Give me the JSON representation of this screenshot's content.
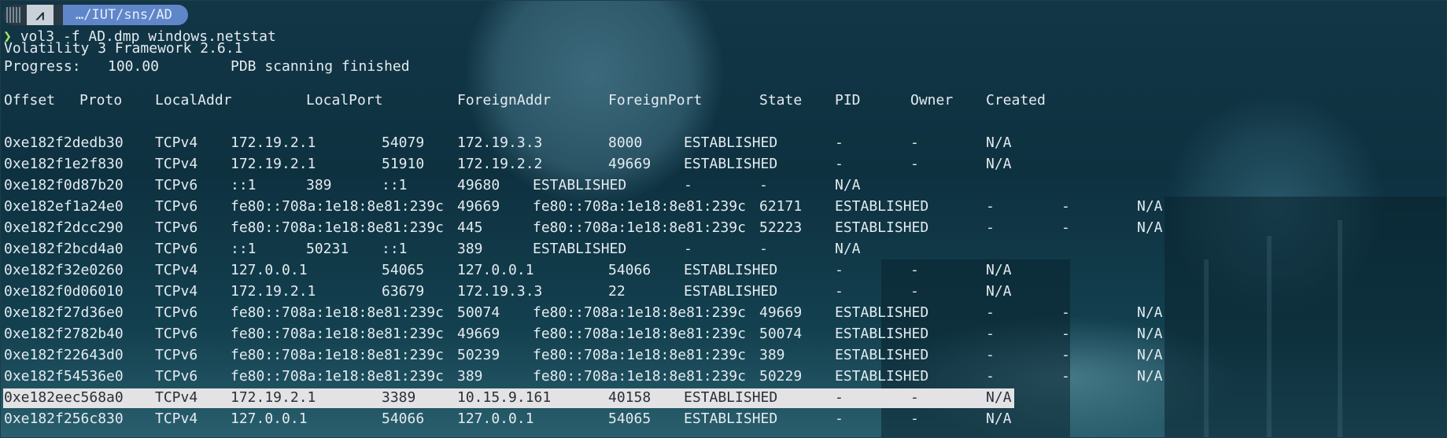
{
  "prompt": {
    "os_icon": "arch-linux-icon",
    "path": "…/IUT/sns/AD"
  },
  "command": {
    "chevron": "❯",
    "text": "vol3 -f AD.dmp windows.netstat"
  },
  "banner": "Volatility 3 Framework 2.6.1",
  "progress": {
    "label": "Progress:",
    "value": "100.00",
    "status": "PDB scanning finished"
  },
  "headers": [
    "Offset",
    "Proto",
    "LocalAddr",
    "LocalPort",
    "ForeignAddr",
    "ForeignPort",
    "State",
    "PID",
    "Owner",
    "Created"
  ],
  "rows": [
    [
      "0xe182f2dedb30",
      "TCPv4",
      "172.19.2.1",
      "54079",
      "172.19.3.3",
      "8000",
      "ESTABLISHED",
      "-",
      "-",
      "N/A"
    ],
    [
      "0xe182f1e2f830",
      "TCPv4",
      "172.19.2.1",
      "51910",
      "172.19.2.2",
      "49669",
      "ESTABLISHED",
      "-",
      "-",
      "N/A"
    ],
    [
      "0xe182f0d87b20",
      "TCPv6",
      "::1",
      "389",
      "::1",
      "49680",
      "ESTABLISHED",
      "-",
      "-",
      "N/A"
    ],
    [
      "0xe182ef1a24e0",
      "TCPv6",
      "fe80::708a:1e18:8e81:239c",
      "49669",
      "fe80::708a:1e18:8e81:239c",
      "62171",
      "ESTABLISHED",
      "-",
      "-",
      "N/A"
    ],
    [
      "0xe182f2dcc290",
      "TCPv6",
      "fe80::708a:1e18:8e81:239c",
      "445",
      "fe80::708a:1e18:8e81:239c",
      "52223",
      "ESTABLISHED",
      "-",
      "-",
      "N/A"
    ],
    [
      "0xe182f2bcd4a0",
      "TCPv6",
      "::1",
      "50231",
      "::1",
      "389",
      "ESTABLISHED",
      "-",
      "-",
      "N/A"
    ],
    [
      "0xe182f32e0260",
      "TCPv4",
      "127.0.0.1",
      "54065",
      "127.0.0.1",
      "54066",
      "ESTABLISHED",
      "-",
      "-",
      "N/A"
    ],
    [
      "0xe182f0d06010",
      "TCPv4",
      "172.19.2.1",
      "63679",
      "172.19.3.3",
      "22",
      "ESTABLISHED",
      "-",
      "-",
      "N/A"
    ],
    [
      "0xe182f27d36e0",
      "TCPv6",
      "fe80::708a:1e18:8e81:239c",
      "50074",
      "fe80::708a:1e18:8e81:239c",
      "49669",
      "ESTABLISHED",
      "-",
      "-",
      "N/A"
    ],
    [
      "0xe182f2782b40",
      "TCPv6",
      "fe80::708a:1e18:8e81:239c",
      "49669",
      "fe80::708a:1e18:8e81:239c",
      "50074",
      "ESTABLISHED",
      "-",
      "-",
      "N/A"
    ],
    [
      "0xe182f22643d0",
      "TCPv6",
      "fe80::708a:1e18:8e81:239c",
      "50239",
      "fe80::708a:1e18:8e81:239c",
      "389",
      "ESTABLISHED",
      "-",
      "-",
      "N/A"
    ],
    [
      "0xe182f54536e0",
      "TCPv6",
      "fe80::708a:1e18:8e81:239c",
      "389",
      "fe80::708a:1e18:8e81:239c",
      "50229",
      "ESTABLISHED",
      "-",
      "-",
      "N/A"
    ],
    [
      "0xe182eec568a0",
      "TCPv4",
      "172.19.2.1",
      "3389",
      "10.15.9.161",
      "40158",
      "ESTABLISHED",
      "-",
      "-",
      "N/A"
    ],
    [
      "0xe182f256c830",
      "TCPv4",
      "127.0.0.1",
      "54066",
      "127.0.0.1",
      "54065",
      "ESTABLISHED",
      "-",
      "-",
      "N/A"
    ]
  ],
  "highlighted_row": 12,
  "colors": {
    "prompt_path_bg": "#5f86c9",
    "prompt_chevron": "#a6e36a",
    "selection_bg": "#e3e3e6",
    "text": "#e4ebf0"
  }
}
